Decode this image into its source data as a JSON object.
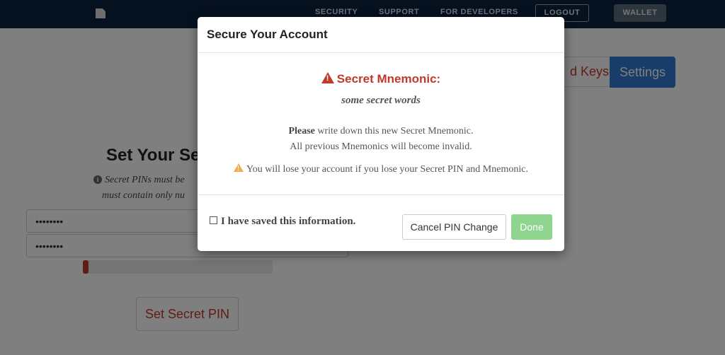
{
  "navbar": {
    "links": [
      "SECURITY",
      "SUPPORT",
      "FOR DEVELOPERS"
    ],
    "logout_label": "LOGOUT",
    "wallet_label": "WALLET"
  },
  "tabs": {
    "keys_label": "d Keys",
    "settings_label": "Settings"
  },
  "set_pin": {
    "title": "Set Your Se",
    "note_line1": "Secret PINs must be",
    "note_line2": "must contain only nu",
    "pin_value": "••••••••",
    "pin_confirm_value": "••••••••",
    "strength": 0.03,
    "button_label": "Set Secret PIN"
  },
  "modal": {
    "title": "Secure Your Account",
    "mnemonic_heading": "Secret Mnemonic:",
    "mnemonic_words": "some secret words",
    "instruction_bold": "Please",
    "instruction_rest": " write down this new Secret Mnemonic.",
    "instruction_line2": "All previous Mnemonics will become invalid.",
    "warning": "You will lose your account if you lose your Secret PIN and Mnemonic.",
    "saved_label": "I have saved this information.",
    "cancel_label": "Cancel PIN Change",
    "done_label": "Done"
  },
  "colors": {
    "nav_bg": "#0c2340",
    "accent_red": "#c0392b",
    "settings_blue": "#2e7ad1",
    "done_green": "#8fd48f",
    "warning_orange": "#f0ad4e"
  }
}
